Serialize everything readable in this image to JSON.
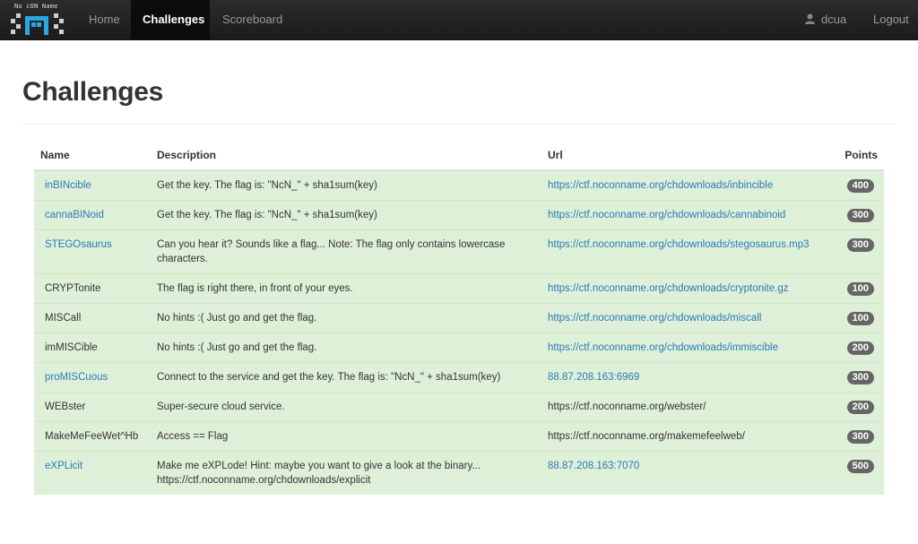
{
  "navbar": {
    "brand_text": "No cON Name",
    "items": [
      {
        "label": "Home",
        "active": false
      },
      {
        "label": "Challenges",
        "active": true
      },
      {
        "label": "Scoreboard",
        "active": false
      }
    ],
    "user": "dcua",
    "logout": "Logout"
  },
  "page": {
    "title": "Challenges"
  },
  "table": {
    "headers": {
      "name": "Name",
      "description": "Description",
      "url": "Url",
      "points": "Points"
    },
    "rows": [
      {
        "name": "inBINcible",
        "name_link": true,
        "description": "Get the key. The flag is: \"NcN_\" + sha1sum(key)",
        "url": "https://ctf.noconname.org/chdownloads/inbincible",
        "url_link": true,
        "points": "400"
      },
      {
        "name": "cannaBINoid",
        "name_link": true,
        "description": "Get the key. The flag is: \"NcN_\" + sha1sum(key)",
        "url": "https://ctf.noconname.org/chdownloads/cannabinoid",
        "url_link": true,
        "points": "300"
      },
      {
        "name": "STEGOsaurus",
        "name_link": true,
        "description": "Can you hear it? Sounds like a flag... Note: The flag only contains lowercase characters.",
        "url": "https://ctf.noconname.org/chdownloads/stegosaurus.mp3",
        "url_link": true,
        "points": "300"
      },
      {
        "name": "CRYPTonite",
        "name_link": false,
        "description": "The flag is right there, in front of your eyes.",
        "url": "https://ctf.noconname.org/chdownloads/cryptonite.gz",
        "url_link": true,
        "points": "100"
      },
      {
        "name": "MISCall",
        "name_link": false,
        "description": "No hints :( Just go and get the flag.",
        "url": "https://ctf.noconname.org/chdownloads/miscall",
        "url_link": true,
        "points": "100"
      },
      {
        "name": "imMISCible",
        "name_link": false,
        "description": "No hints :( Just go and get the flag.",
        "url": "https://ctf.noconname.org/chdownloads/immiscible",
        "url_link": true,
        "points": "200"
      },
      {
        "name": "proMISCuous",
        "name_link": true,
        "description": "Connect to the service and get the key. The flag is: \"NcN_\" + sha1sum(key)",
        "url": "88.87.208.163:6969",
        "url_link": true,
        "points": "300"
      },
      {
        "name": "WEBster",
        "name_link": false,
        "description": "Super-secure cloud service.",
        "url": "https://ctf.noconname.org/webster/",
        "url_link": false,
        "points": "200"
      },
      {
        "name": "MakeMeFeeWet^Hb",
        "name_link": false,
        "description": "Access == Flag",
        "url": "https://ctf.noconname.org/makemefeelweb/",
        "url_link": false,
        "points": "300"
      },
      {
        "name": "eXPLicit",
        "name_link": true,
        "description": "Make me eXPLode! Hint: maybe you want to give a look at the binary... https://ctf.noconname.org/chdownloads/explicit",
        "url": "88.87.208.163:7070",
        "url_link": true,
        "points": "500"
      }
    ]
  }
}
